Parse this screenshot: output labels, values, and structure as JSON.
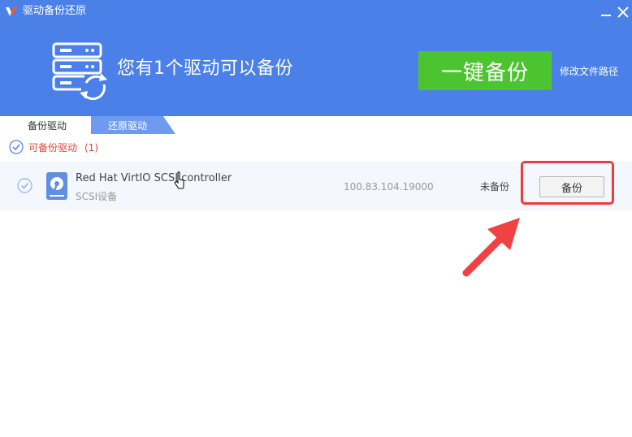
{
  "window": {
    "title": "驱动备份还原",
    "minimize_icon": "minimize-icon",
    "close_icon": "close-icon"
  },
  "banner": {
    "icon": "server-refresh-icon",
    "headline": "您有1个驱动可以备份",
    "backup_all_label": "一键备份",
    "change_path_label": "修改文件路径"
  },
  "tabs": [
    {
      "label": "备份驱动",
      "active": true
    },
    {
      "label": "还原驱动",
      "active": false
    }
  ],
  "section": {
    "label": "可备份驱动",
    "count": "(1)"
  },
  "drivers": [
    {
      "name": "Red Hat VirtIO SCSI controller",
      "type": "SCSI设备",
      "version": "100.83.104.19000",
      "status": "未备份",
      "action_label": "备份"
    }
  ],
  "colors": {
    "header_bg": "#4a80e8",
    "primary_green": "#4cc42f",
    "alert_red": "#e8453c",
    "highlight_red": "#ee3b3b"
  }
}
